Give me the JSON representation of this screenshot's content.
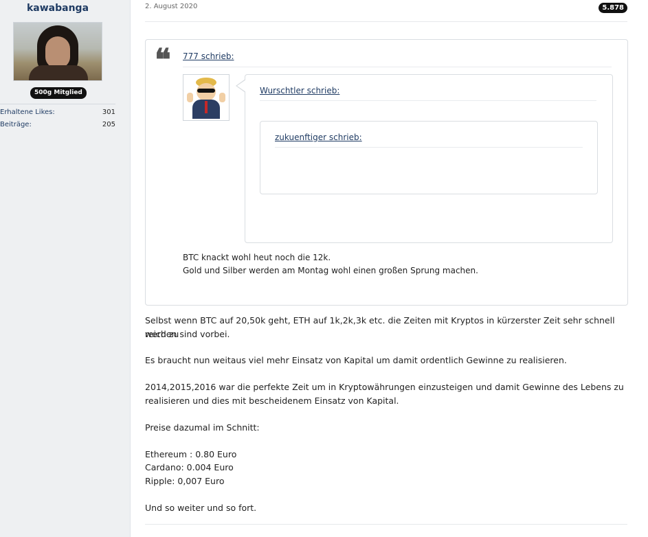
{
  "author": {
    "name": "kawabanga",
    "rank": "500g Mitglied",
    "stats": [
      {
        "label": "Erhaltene Likes:",
        "value": "301"
      },
      {
        "label": "Beiträge:",
        "value": "205"
      }
    ]
  },
  "post": {
    "date": "2. August 2020",
    "number": "5.878",
    "quote_outer": {
      "title": "777 schrieb:",
      "text_lines": [
        "BTC knackt wohl heut noch die 12k.",
        "Gold und Silber werden am Montag wohl einen großen Sprung machen."
      ]
    },
    "quote_mid": {
      "title": "Wurschtler schrieb:"
    },
    "quote_inner": {
      "title": "zukuenftiger schrieb:"
    },
    "body_lines": [
      "Selbst wenn BTC auf 20,50k geht, ETH auf 1k,2k,3k etc. die Zeiten mit Kryptos in kürzerster Zeit sehr schnell reich zu",
      "werden sind vorbei.",
      "Es braucht nun weitaus viel mehr Einsatz von Kapital um damit ordentlich Gewinne zu realisieren.",
      "2014,2015,2016 war die perfekte Zeit um in Kryptowährungen einzusteigen und damit Gewinne des Lebens zu",
      "realisieren und dies mit bescheidenem Einsatz von Kapital.",
      "Preise dazumal im Schnitt:",
      "Ethereum : 0.80 Euro",
      "Cardano: 0.004 Euro",
      "Ripple: 0,007 Euro",
      "Und so weiter und so fort."
    ]
  }
}
